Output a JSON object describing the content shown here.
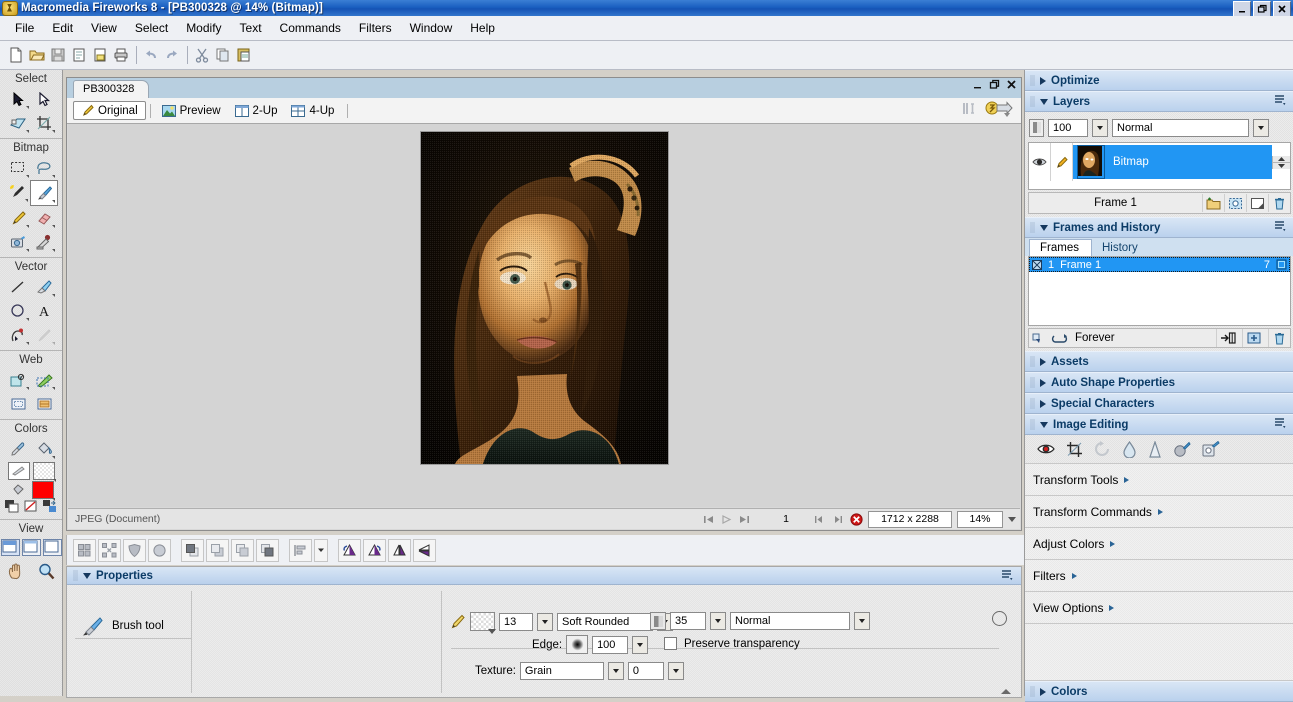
{
  "window": {
    "title": "Macromedia Fireworks 8 - [PB300328 @  14% (Bitmap)]",
    "minimize": "_",
    "restore": "❐",
    "close": "✕"
  },
  "menubar": {
    "items": [
      "File",
      "Edit",
      "View",
      "Select",
      "Modify",
      "Text",
      "Commands",
      "Filters",
      "Window",
      "Help"
    ]
  },
  "toolbar": {
    "buttons": [
      "new-icon",
      "open-icon",
      "save-icon",
      "import-icon",
      "export-icon",
      "print-icon",
      "undo-icon",
      "redo-icon",
      "cut-icon",
      "copy-icon",
      "paste-icon"
    ]
  },
  "tools": {
    "sections": [
      {
        "title": "Select",
        "icons": [
          "pointer-tool",
          "subselection-tool",
          "select-behind-tool",
          "crop-tool"
        ]
      },
      {
        "title": "Bitmap",
        "icons": [
          "marquee-tool",
          "lasso-tool",
          "magic-wand-tool",
          "brush-tool",
          "pencil-tool",
          "eraser-tool",
          "blur-tool",
          "rubber-stamp-tool"
        ]
      },
      {
        "title": "Vector",
        "icons": [
          "line-tool",
          "vector-path-tool",
          "ellipse-tool",
          "text-tool",
          "pen-tool",
          "freeform-tool"
        ]
      },
      {
        "title": "Web",
        "icons": [
          "rectangle-hotspot-tool",
          "slice-tool",
          "hide-slices-tool",
          "show-slices-tool"
        ]
      },
      {
        "title": "Colors",
        "icons": [
          "eyedropper-tool",
          "paint-bucket-tool"
        ]
      },
      {
        "title": "View",
        "icons": [
          "standard-screen-mode",
          "full-screen-mode",
          "full-screen-no-menus",
          "hand-tool",
          "zoom-tool"
        ]
      }
    ],
    "selected": "brush-tool"
  },
  "document": {
    "tab_label": "PB300328",
    "win_minimize": "_",
    "win_restore": "❐",
    "win_close": "✕",
    "view_tabs": [
      {
        "label": "Original",
        "icon": "pencil-icon",
        "active": true
      },
      {
        "label": "Preview",
        "icon": "image-icon",
        "active": false
      },
      {
        "label": "2-Up",
        "icon": "two-up-icon",
        "active": false
      },
      {
        "label": "4-Up",
        "icon": "four-up-icon",
        "active": false
      }
    ],
    "status": {
      "file_type": "JPEG (Document)",
      "frame_number": "1",
      "dimensions": "1712 x 2288",
      "zoom": "14%",
      "nav_icons": [
        "first-frame-icon",
        "play-icon",
        "last-frame-icon",
        "prev-frame-icon",
        "next-frame-icon",
        "stop-icon"
      ]
    }
  },
  "properties": {
    "title": "Properties",
    "tool_name": "Brush tool",
    "tool_icon": "brush-icon",
    "stroke_size": "13",
    "stroke_type": "Soft Rounded",
    "edge_label": "Edge:",
    "edge_value": "100",
    "texture_label": "Texture:",
    "texture_name": "Grain",
    "texture_amount": "0",
    "opacity": "35",
    "blend_mode": "Normal",
    "preserve_transparency_label": "Preserve transparency",
    "preserve_transparency_checked": false,
    "help_icon": "question-mark-icon"
  },
  "dock": {
    "optimize": {
      "title": "Optimize",
      "expanded": false
    },
    "layers": {
      "title": "Layers",
      "expanded": true,
      "opacity": "100",
      "blend_mode": "Normal",
      "layer_name": "Bitmap",
      "frame_label": "Frame 1",
      "buttons": [
        "new-folder-icon",
        "new-bitmap-icon",
        "new-layer-icon",
        "delete-icon"
      ],
      "eye_icon": "eye-icon",
      "pencil_icon": "pencil-icon"
    },
    "frames_history": {
      "title": "Frames and History",
      "expanded": true,
      "tabs": [
        {
          "label": "Frames",
          "active": true
        },
        {
          "label": "History",
          "active": false
        }
      ],
      "frame_row": {
        "number": "1",
        "name": "Frame 1",
        "delay": "7"
      },
      "loop_label": "Forever",
      "toolbar_icons": [
        "onion-skin-icon",
        "loop-icon",
        "distribute-icon",
        "new-frame-icon",
        "delete-frame-icon"
      ]
    },
    "collapsed_panels": [
      {
        "title": "Assets",
        "expanded": false
      },
      {
        "title": "Auto Shape Properties",
        "expanded": false
      },
      {
        "title": "Special Characters",
        "expanded": false
      }
    ],
    "image_editing": {
      "title": "Image Editing",
      "expanded": true,
      "icons": [
        "red-eye-removal-icon",
        "crop-icon",
        "rotate-icon",
        "blur-icon",
        "sharpen-icon",
        "dodge-icon",
        "smudge-icon"
      ]
    },
    "command_items": [
      {
        "label": "Transform Tools"
      },
      {
        "label": "Transform Commands"
      },
      {
        "label": "Adjust Colors"
      },
      {
        "label": "Filters"
      },
      {
        "label": "View Options"
      }
    ],
    "colors": {
      "title": "Colors",
      "expanded": false
    }
  }
}
